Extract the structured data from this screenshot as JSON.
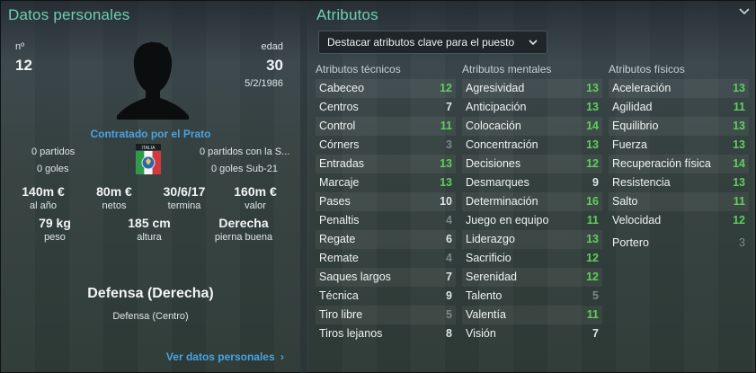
{
  "colors": {
    "accent_title": "#6fcfb0",
    "link": "#4aa3df",
    "value_high": "#5ed05a",
    "value_mid": "#dfe5e8",
    "value_low": "#7c878c"
  },
  "left": {
    "title": "Datos personales",
    "number_label": "nº",
    "number": "12",
    "age_label": "edad",
    "age": "30",
    "birthdate": "5/2/1986",
    "contract": "Contratado por el Prato",
    "flag_text": "ITALIA",
    "matches": "0 partidos",
    "goals": "0 goles",
    "u21_matches": "0 partidos con la S...",
    "u21_goals": "0 goles Sub-21",
    "stats": [
      {
        "value": "140m €",
        "label": "al año"
      },
      {
        "value": "80m €",
        "label": "netos"
      },
      {
        "value": "30/6/17",
        "label": "termina"
      },
      {
        "value": "160m €",
        "label": "valor"
      },
      {
        "value": "79 kg",
        "label": "peso"
      },
      {
        "value": "185 cm",
        "label": "altura"
      },
      {
        "value": "Derecha",
        "label": "pierna buena"
      }
    ],
    "position_main": "Defensa (Derecha)",
    "position_sub": "Defensa (Centro)",
    "personal_link": "Ver datos personales"
  },
  "right": {
    "title": "Atributos",
    "collapse_icon": "chevron-down-icon",
    "dropdown_label": "Destacar atributos clave para el puesto",
    "technical_header": "Atributos técnicos",
    "mental_header": "Atributos mentales",
    "physical_header": "Atributos físicos",
    "technical": [
      {
        "name": "Cabeceo",
        "value": "12",
        "tone": "green"
      },
      {
        "name": "Centros",
        "value": "7",
        "tone": "light"
      },
      {
        "name": "Control",
        "value": "11",
        "tone": "green"
      },
      {
        "name": "Córners",
        "value": "3",
        "tone": "gray"
      },
      {
        "name": "Entradas",
        "value": "13",
        "tone": "green"
      },
      {
        "name": "Marcaje",
        "value": "13",
        "tone": "green"
      },
      {
        "name": "Pases",
        "value": "10",
        "tone": "light"
      },
      {
        "name": "Penaltis",
        "value": "4",
        "tone": "gray"
      },
      {
        "name": "Regate",
        "value": "6",
        "tone": "light"
      },
      {
        "name": "Remate",
        "value": "4",
        "tone": "gray"
      },
      {
        "name": "Saques largos",
        "value": "7",
        "tone": "light"
      },
      {
        "name": "Técnica",
        "value": "9",
        "tone": "light"
      },
      {
        "name": "Tiro libre",
        "value": "5",
        "tone": "gray"
      },
      {
        "name": "Tiros lejanos",
        "value": "8",
        "tone": "light"
      }
    ],
    "mental": [
      {
        "name": "Agresividad",
        "value": "13",
        "tone": "green"
      },
      {
        "name": "Anticipación",
        "value": "13",
        "tone": "green"
      },
      {
        "name": "Colocación",
        "value": "14",
        "tone": "green"
      },
      {
        "name": "Concentración",
        "value": "13",
        "tone": "green"
      },
      {
        "name": "Decisiones",
        "value": "12",
        "tone": "green"
      },
      {
        "name": "Desmarques",
        "value": "9",
        "tone": "light"
      },
      {
        "name": "Determinación",
        "value": "16",
        "tone": "green"
      },
      {
        "name": "Juego en equipo",
        "value": "11",
        "tone": "green"
      },
      {
        "name": "Liderazgo",
        "value": "13",
        "tone": "green"
      },
      {
        "name": "Sacrificio",
        "value": "12",
        "tone": "green"
      },
      {
        "name": "Serenidad",
        "value": "12",
        "tone": "green"
      },
      {
        "name": "Talento",
        "value": "5",
        "tone": "gray"
      },
      {
        "name": "Valentía",
        "value": "11",
        "tone": "green"
      },
      {
        "name": "Visión",
        "value": "7",
        "tone": "light"
      }
    ],
    "physical": [
      {
        "name": "Aceleración",
        "value": "13",
        "tone": "green"
      },
      {
        "name": "Agilidad",
        "value": "11",
        "tone": "green"
      },
      {
        "name": "Equilibrio",
        "value": "13",
        "tone": "green"
      },
      {
        "name": "Fuerza",
        "value": "13",
        "tone": "green"
      },
      {
        "name": "Recuperación física",
        "value": "14",
        "tone": "green"
      },
      {
        "name": "Resistencia",
        "value": "13",
        "tone": "green"
      },
      {
        "name": "Salto",
        "value": "11",
        "tone": "green"
      },
      {
        "name": "Velocidad",
        "value": "12",
        "tone": "green"
      }
    ],
    "goalkeeper": {
      "name": "Portero",
      "value": "3",
      "tone": "gray"
    }
  }
}
